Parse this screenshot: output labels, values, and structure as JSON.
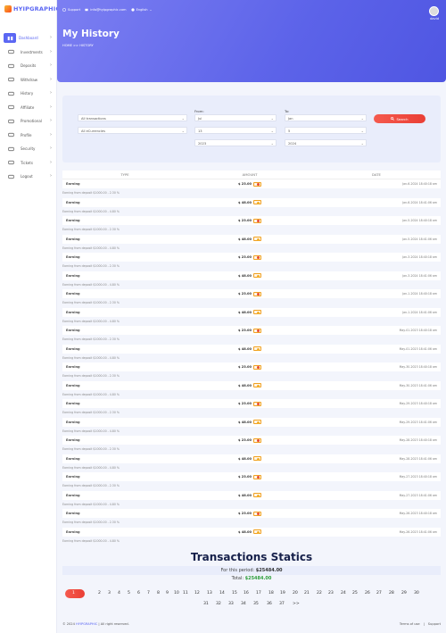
{
  "brand": {
    "name": "HYIPGRAPHIC"
  },
  "topbar": {
    "support": "Support",
    "email": "info@hyipgraphic.com",
    "language": "English",
    "user": "david"
  },
  "sidebar": {
    "items": [
      {
        "label": "Dashboard",
        "icon": "dashboard-icon",
        "active": true
      },
      {
        "label": "Investments",
        "icon": "investments-icon"
      },
      {
        "label": "Deposits",
        "icon": "deposits-icon"
      },
      {
        "label": "Withdraw",
        "icon": "withdraw-icon"
      },
      {
        "label": "History",
        "icon": "history-icon"
      },
      {
        "label": "Affiliate",
        "icon": "affiliate-icon"
      },
      {
        "label": "Promotional",
        "icon": "promotional-icon"
      },
      {
        "label": "Profile",
        "icon": "profile-icon"
      },
      {
        "label": "Security",
        "icon": "security-icon"
      },
      {
        "label": "Tickets",
        "icon": "tickets-icon"
      },
      {
        "label": "Logout",
        "icon": "logout-icon"
      }
    ]
  },
  "page": {
    "title": "My History",
    "breadcrumb": "HOME  >>  HISTORY"
  },
  "filter": {
    "type_select": "All transactions",
    "currency_select": "All eCurrencies",
    "from_label": "From:",
    "to_label": "To:",
    "from_month": "Jul",
    "from_day": "13",
    "from_year": "2023",
    "to_month": "Jan",
    "to_day": "5",
    "to_year": "2024",
    "search_label": "Search"
  },
  "table": {
    "headers": [
      "TYPE",
      "AMOUNT",
      "DATE"
    ],
    "rows": [
      {
        "type": "Earning",
        "amount": "$ 23.00",
        "date": "Jan-6-2024 18:40:18 am",
        "note": "Earning from deposit $1000.00 - 2.30 %",
        "coin": "red"
      },
      {
        "type": "Earning",
        "amount": "$ 48.00",
        "date": "Jan-6-2024 18:41:06 am",
        "note": "Earning from deposit $1000.00 - 4.80 %",
        "coin": "amber"
      },
      {
        "type": "Earning",
        "amount": "$ 23.00",
        "date": "Jan-5-2024 18:40:18 am",
        "note": "Earning from deposit $1000.00 - 2.30 %",
        "coin": "red"
      },
      {
        "type": "Earning",
        "amount": "$ 48.00",
        "date": "Jan-5-2024 18:41:06 am",
        "note": "Earning from deposit $1000.00 - 4.80 %",
        "coin": "amber"
      },
      {
        "type": "Earning",
        "amount": "$ 23.00",
        "date": "Jan-3-2024 18:40:18 am",
        "note": "Earning from deposit $1000.00 - 2.30 %",
        "coin": "red"
      },
      {
        "type": "Earning",
        "amount": "$ 48.00",
        "date": "Jan-3-2024 18:41:06 am",
        "note": "Earning from deposit $1000.00 - 4.80 %",
        "coin": "amber"
      },
      {
        "type": "Earning",
        "amount": "$ 23.00",
        "date": "Jan-1-2024 18:40:18 am",
        "note": "Earning from deposit $1000.00 - 2.30 %",
        "coin": "red"
      },
      {
        "type": "Earning",
        "amount": "$ 48.00",
        "date": "Jan-1-2024 18:41:06 am",
        "note": "Earning from deposit $1000.00 - 4.80 %",
        "coin": "amber"
      },
      {
        "type": "Earning",
        "amount": "$ 23.00",
        "date": "May-01-2023 18:40:18 am",
        "note": "Earning from deposit $1000.00 - 2.30 %",
        "coin": "red"
      },
      {
        "type": "Earning",
        "amount": "$ 48.00",
        "date": "May-01-2023 18:41:06 am",
        "note": "Earning from deposit $1000.00 - 4.80 %",
        "coin": "amber"
      },
      {
        "type": "Earning",
        "amount": "$ 23.00",
        "date": "May-30-2023 18:40:18 am",
        "note": "Earning from deposit $1000.00 - 2.30 %",
        "coin": "red"
      },
      {
        "type": "Earning",
        "amount": "$ 48.00",
        "date": "May-30-2023 18:41:06 am",
        "note": "Earning from deposit $1000.00 - 4.80 %",
        "coin": "amber"
      },
      {
        "type": "Earning",
        "amount": "$ 23.00",
        "date": "May-29-2023 18:40:18 am",
        "note": "Earning from deposit $1000.00 - 2.30 %",
        "coin": "red"
      },
      {
        "type": "Earning",
        "amount": "$ 48.00",
        "date": "May-29-2023 18:41:06 am",
        "note": "Earning from deposit $1000.00 - 4.80 %",
        "coin": "amber"
      },
      {
        "type": "Earning",
        "amount": "$ 23.00",
        "date": "May-28-2023 18:40:18 am",
        "note": "Earning from deposit $1000.00 - 2.30 %",
        "coin": "red"
      },
      {
        "type": "Earning",
        "amount": "$ 48.00",
        "date": "May-28-2023 18:41:06 am",
        "note": "Earning from deposit $1000.00 - 4.80 %",
        "coin": "amber"
      },
      {
        "type": "Earning",
        "amount": "$ 23.00",
        "date": "May-27-2023 18:40:18 am",
        "note": "Earning from deposit $1000.00 - 2.30 %",
        "coin": "red"
      },
      {
        "type": "Earning",
        "amount": "$ 48.00",
        "date": "May-27-2023 18:41:06 am",
        "note": "Earning from deposit $1000.00 - 4.80 %",
        "coin": "amber"
      },
      {
        "type": "Earning",
        "amount": "$ 23.00",
        "date": "May-26-2023 18:40:18 am",
        "note": "Earning from deposit $1000.00 - 2.30 %",
        "coin": "red"
      },
      {
        "type": "Earning",
        "amount": "$ 48.00",
        "date": "May-26-2023 18:41:06 am",
        "note": "Earning from deposit $1000.00 - 4.80 %",
        "coin": "amber"
      }
    ]
  },
  "stats": {
    "title": "Transactions Statics",
    "period_label": "For this period:",
    "period_value": "$25484.00",
    "total_label": "Total:",
    "total_value": "$25484.00"
  },
  "pagination": {
    "active": "1",
    "row1": [
      "2",
      "3",
      "4",
      "5",
      "6",
      "7",
      "8",
      "9",
      "10",
      "11",
      "12",
      "13",
      "14",
      "15",
      "16",
      "17",
      "18",
      "19",
      "20",
      "21",
      "22",
      "23",
      "24",
      "25",
      "26",
      "27",
      "28",
      "29",
      "30"
    ],
    "row2": [
      "31",
      "32",
      "33",
      "34",
      "35",
      "36",
      "37",
      ">>"
    ]
  },
  "footer": {
    "copyright": "© 2024",
    "brand": "HYIPGRAPHIC",
    "rights": "| All right reserved.",
    "terms": "Terms of use",
    "sep": "|",
    "support": "Support"
  },
  "colors": {
    "accent": "#5b67f3",
    "button": "#ea3f35"
  }
}
